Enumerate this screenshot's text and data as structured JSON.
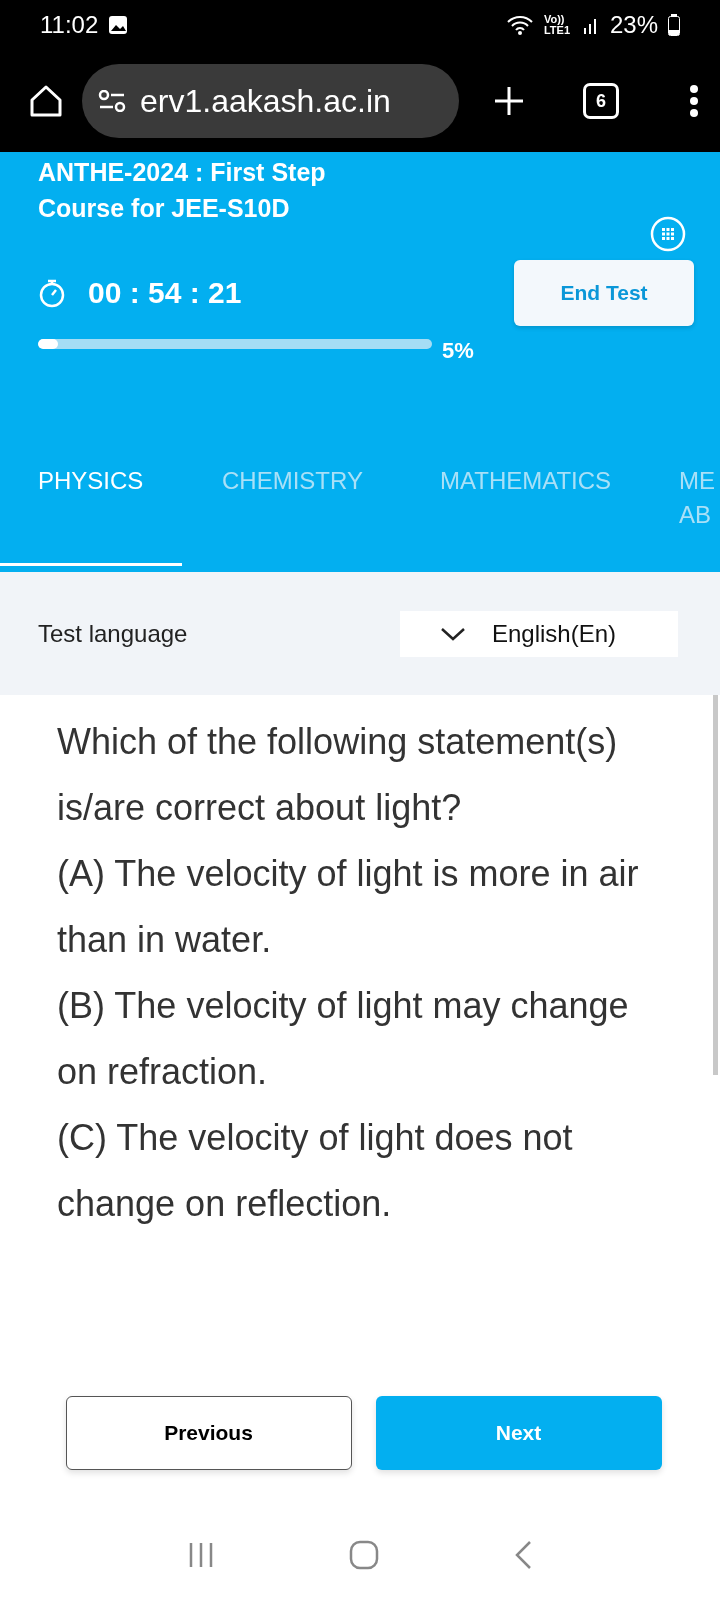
{
  "status_bar": {
    "time": "11:02",
    "network": "Vo)) LTE1",
    "battery": "23%"
  },
  "browser": {
    "url": "erv1.aakash.ac.in",
    "tab_count": "6"
  },
  "header": {
    "title": "ANTHE-2024 : First Step Course for JEE-S10D",
    "timer": "00 : 54 : 21",
    "progress": {
      "level": 0.05,
      "reading": "5%"
    },
    "end_button": "End Test"
  },
  "tabs": [
    {
      "label": "PHYSICS",
      "selected": true
    },
    {
      "label": "CHEMISTRY",
      "selected": false
    },
    {
      "label": "MATHEMATICS",
      "selected": false
    },
    {
      "label": "ME AB",
      "selected": false
    }
  ],
  "language": {
    "label": "Test language",
    "value": "English(En)"
  },
  "question": {
    "text": "Which of the following statement(s) is/are correct about light?",
    "statements": [
      "(A) The velocity of light is more in air than in water.",
      "(B) The velocity of light may change on refraction.",
      "(C) The velocity of light does not change on reflection."
    ]
  },
  "buttons": {
    "previous": "Previous",
    "next": "Next"
  }
}
